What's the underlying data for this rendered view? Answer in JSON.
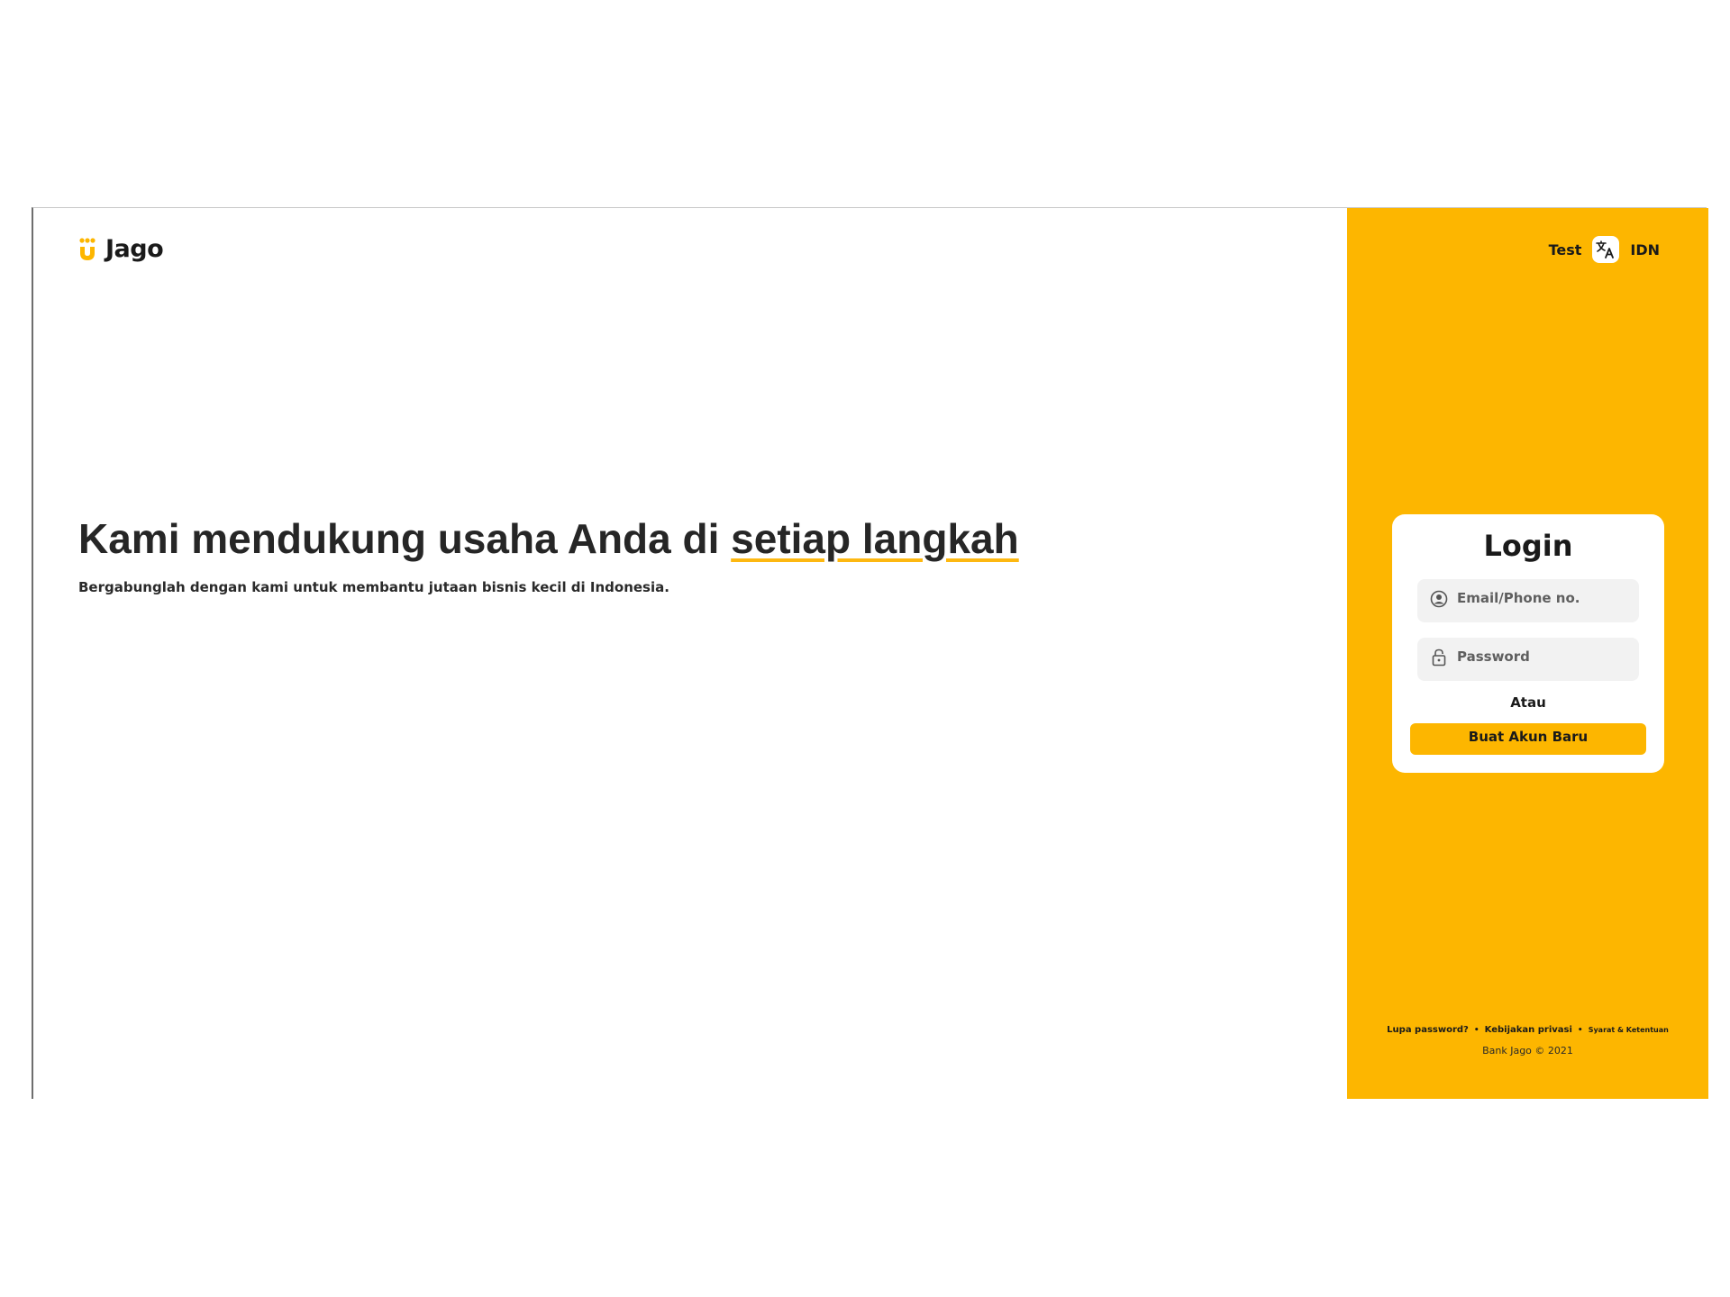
{
  "brand": {
    "name": "Jago",
    "accent_color": "#fdb600"
  },
  "header": {
    "user_label": "Test",
    "language_icon": "translate-icon",
    "language_code": "IDN"
  },
  "hero": {
    "title_prefix": "Kami mendukung usaha Anda di ",
    "title_highlight": "setiap langkah",
    "subtitle": "Bergabunglah dengan kami untuk membantu jutaan bisnis kecil di Indonesia."
  },
  "login": {
    "title": "Login",
    "email_icon": "user-circle-icon",
    "email_placeholder": "Email/Phone no.",
    "password_icon": "lock-icon",
    "password_placeholder": "Password",
    "divider_text": "Atau",
    "create_account_label": "Buat Akun Baru"
  },
  "footer": {
    "links": [
      "Lupa password?",
      "Kebijakan privasi",
      "Syarat & Ketentuan"
    ],
    "separator": "•",
    "copyright": "Bank Jago © 2021"
  }
}
